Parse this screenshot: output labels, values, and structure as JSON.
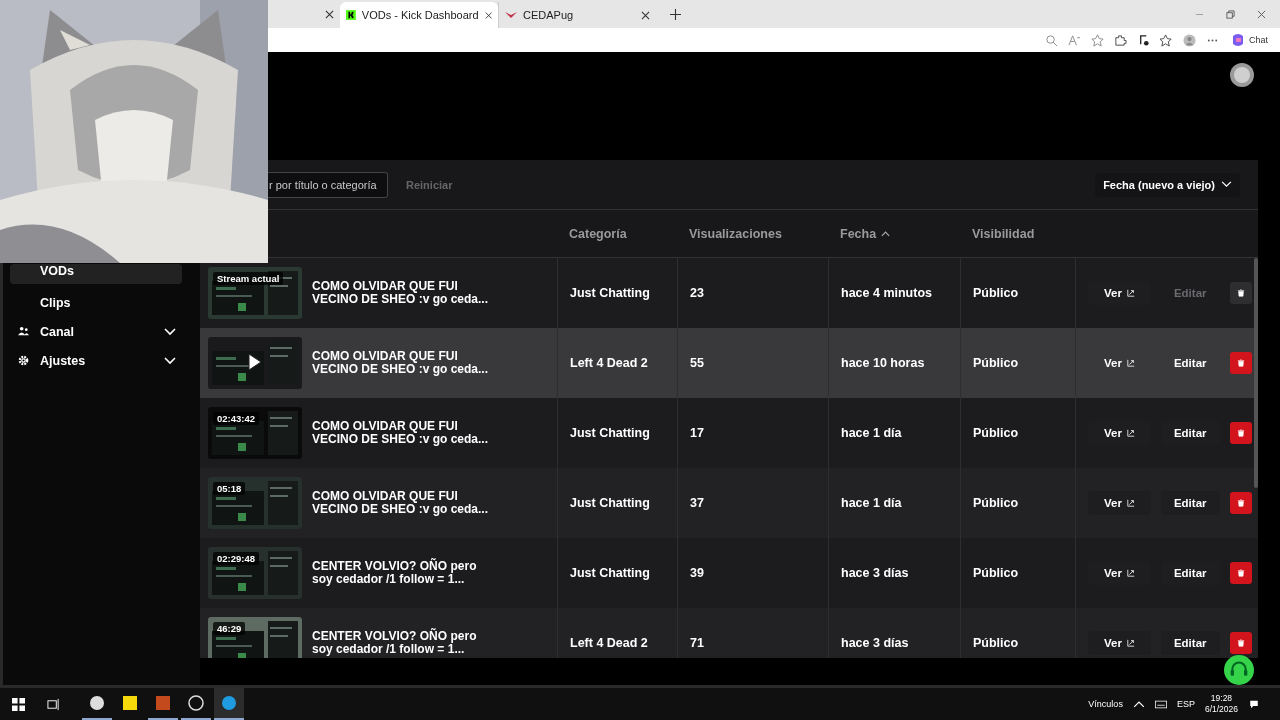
{
  "browser": {
    "tabs": [
      {
        "label": "VODs - Kick Dashboard",
        "selected": true
      },
      {
        "label": "CEDAPug",
        "selected": false
      }
    ],
    "chat_label": "Chat"
  },
  "sidebar": {
    "items": [
      {
        "label": "VODs",
        "selected": true,
        "kind": "sub"
      },
      {
        "label": "Clips",
        "selected": false,
        "kind": "sub"
      },
      {
        "label": "Canal",
        "selected": false,
        "kind": "group"
      },
      {
        "label": "Ajustes",
        "selected": false,
        "kind": "group"
      }
    ]
  },
  "toolbar": {
    "search_placeholder": "r por título o categoría",
    "reset_label": "Reiniciar",
    "sort_label": "Fecha (nuevo a viejo)"
  },
  "table": {
    "columns": [
      "Categoría",
      "Visualizaciones",
      "Fecha",
      "Visibilidad"
    ],
    "rows": [
      {
        "badge": "Stream actual",
        "title": "COMO OLVIDAR QUE FUI VECINO DE SHEO :v go ceda...",
        "category": "Just Chatting",
        "views": "23",
        "date": "hace 4 minutos",
        "visibility": "Público",
        "view_label": "Ver",
        "edit_label": "Editar",
        "hovered": false,
        "disabled": true
      },
      {
        "title": "COMO OLVIDAR QUE FUI VECINO DE SHEO :v go ceda...",
        "category": "Left 4 Dead 2",
        "views": "55",
        "date": "hace 10 horas",
        "visibility": "Público",
        "view_label": "Ver",
        "edit_label": "Editar",
        "hovered": true,
        "disabled": false
      },
      {
        "badge": "02:43:42",
        "title": "COMO OLVIDAR QUE FUI VECINO DE SHEO :v go ceda...",
        "category": "Just Chatting",
        "views": "17",
        "date": "hace 1 día",
        "visibility": "Público",
        "view_label": "Ver",
        "edit_label": "Editar",
        "hovered": false,
        "disabled": false
      },
      {
        "badge": "05:18",
        "title": "COMO OLVIDAR QUE FUI VECINO DE SHEO :v go ceda...",
        "category": "Just Chatting",
        "views": "37",
        "date": "hace 1 día",
        "visibility": "Público",
        "view_label": "Ver",
        "edit_label": "Editar",
        "hovered": false,
        "disabled": false
      },
      {
        "badge": "02:29:48",
        "title": "CENTER VOLVIO? OÑO pero soy cedador /1 follow = 1...",
        "category": "Just Chatting",
        "views": "39",
        "date": "hace 3 días",
        "visibility": "Público",
        "view_label": "Ver",
        "edit_label": "Editar",
        "hovered": false,
        "disabled": false
      },
      {
        "badge": "46:29",
        "title": "CENTER VOLVIO? OÑO pero soy cedador /1 follow = 1...",
        "category": "Left 4 Dead 2",
        "views": "71",
        "date": "hace 3 días",
        "visibility": "Público",
        "view_label": "Ver",
        "edit_label": "Editar",
        "hovered": false,
        "disabled": false
      }
    ]
  },
  "taskbar": {
    "apps": [
      {
        "running": true,
        "selected": false
      },
      {
        "running": false,
        "selected": false
      },
      {
        "running": true,
        "selected": false
      },
      {
        "running": true,
        "selected": false
      },
      {
        "running": true,
        "selected": true
      }
    ],
    "links_label": "Vínculos",
    "language": "ESP",
    "time": "19:28",
    "date": "6/1/2026"
  }
}
